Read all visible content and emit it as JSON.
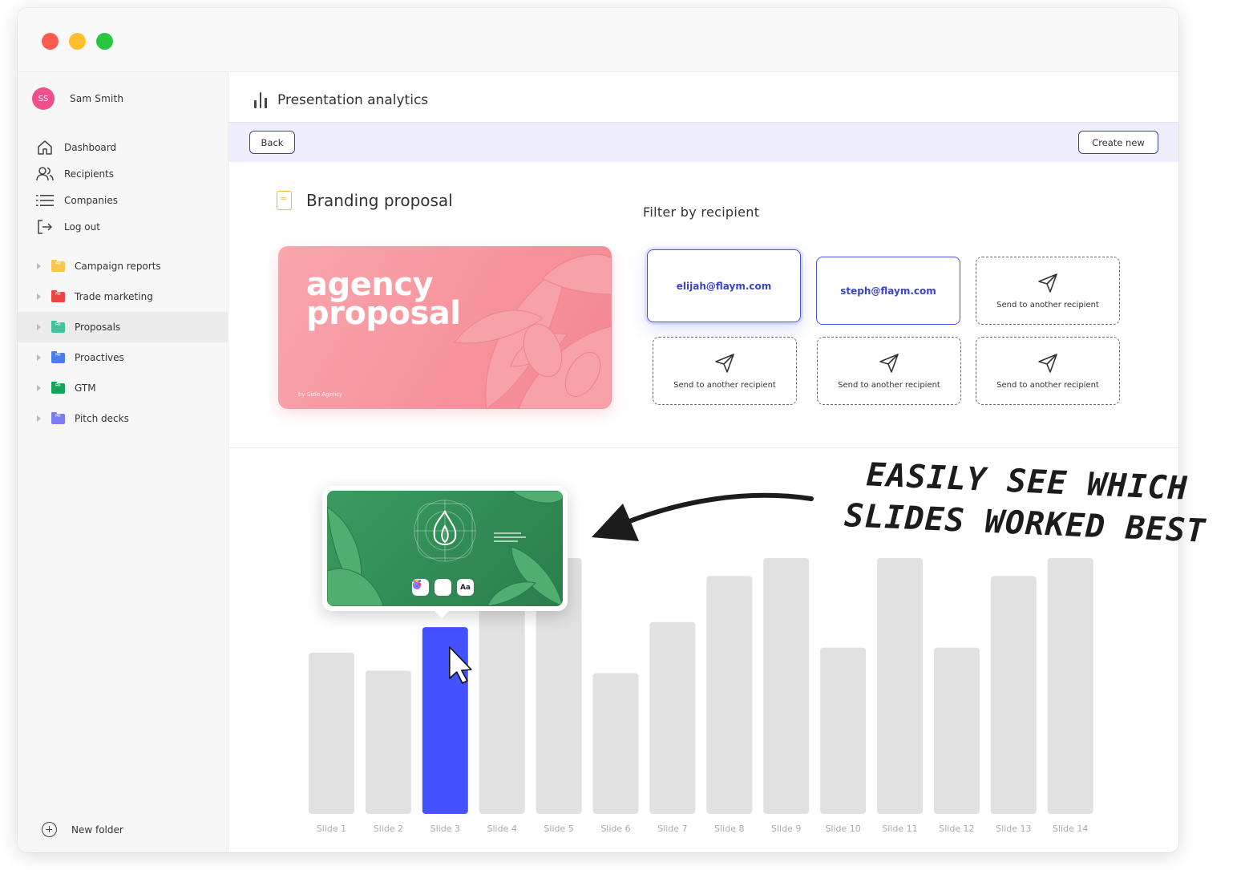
{
  "user": {
    "initials": "SS",
    "name": "Sam Smith"
  },
  "nav": [
    {
      "label": "Dashboard",
      "icon": "home-icon"
    },
    {
      "label": "Recipients",
      "icon": "users-icon"
    },
    {
      "label": "Companies",
      "icon": "list-icon"
    },
    {
      "label": "Log out",
      "icon": "logout-icon"
    }
  ],
  "folders": [
    {
      "label": "Campaign reports",
      "color": "#f9c74f"
    },
    {
      "label": "Trade marketing",
      "color": "#ef4444"
    },
    {
      "label": "Proposals",
      "color": "#3fc49a",
      "active": true
    },
    {
      "label": "Proactives",
      "color": "#4a7cf0"
    },
    {
      "label": "GTM",
      "color": "#16a35a"
    },
    {
      "label": "Pitch decks",
      "color": "#7b7cf0"
    }
  ],
  "new_folder_label": "New folder",
  "page_title": "Presentation analytics",
  "toolbar": {
    "back_label": "Back",
    "create_label": "Create new"
  },
  "document": {
    "title": "Branding proposal",
    "thumb_title_line1": "agency",
    "thumb_title_line2": "proposal",
    "thumb_byline": "by Sizle Agency"
  },
  "filter": {
    "label": "Filter by recipient",
    "recipients": [
      {
        "label": "elijah@flaym.com",
        "kind": "email",
        "selected": true
      },
      {
        "label": "steph@flaym.com",
        "kind": "email",
        "selected": false
      },
      {
        "label": "Send to another recipient",
        "kind": "empty"
      },
      {
        "label": "Send to another recipient",
        "kind": "empty"
      },
      {
        "label": "Send to another recipient",
        "kind": "empty"
      },
      {
        "label": "Send to another recipient",
        "kind": "empty"
      }
    ]
  },
  "preview": {
    "tile_text": "Aa"
  },
  "annotation": {
    "line1": "EASILY SEE WHICH",
    "line2": "SLIDES WORKED BEST"
  },
  "colors": {
    "accent": "#4351ff",
    "bar": "#e1e1e1",
    "toolbar_bg": "#eeeefc"
  },
  "chart_data": {
    "type": "bar",
    "categories": [
      "Slide 1",
      "Slide 2",
      "Slide 3",
      "Slide 4",
      "Slide 5",
      "Slide 6",
      "Slide 7",
      "Slide 8",
      "Slide 9",
      "Slide 10",
      "Slide 11",
      "Slide 12",
      "Slide 13",
      "Slide 14"
    ],
    "values": [
      63,
      56,
      73,
      95,
      100,
      55,
      75,
      93,
      100,
      65,
      100,
      65,
      93,
      100
    ],
    "highlight_index": 2,
    "ylim": [
      0,
      100
    ],
    "grid": false,
    "title": "",
    "xlabel": "",
    "ylabel": ""
  }
}
